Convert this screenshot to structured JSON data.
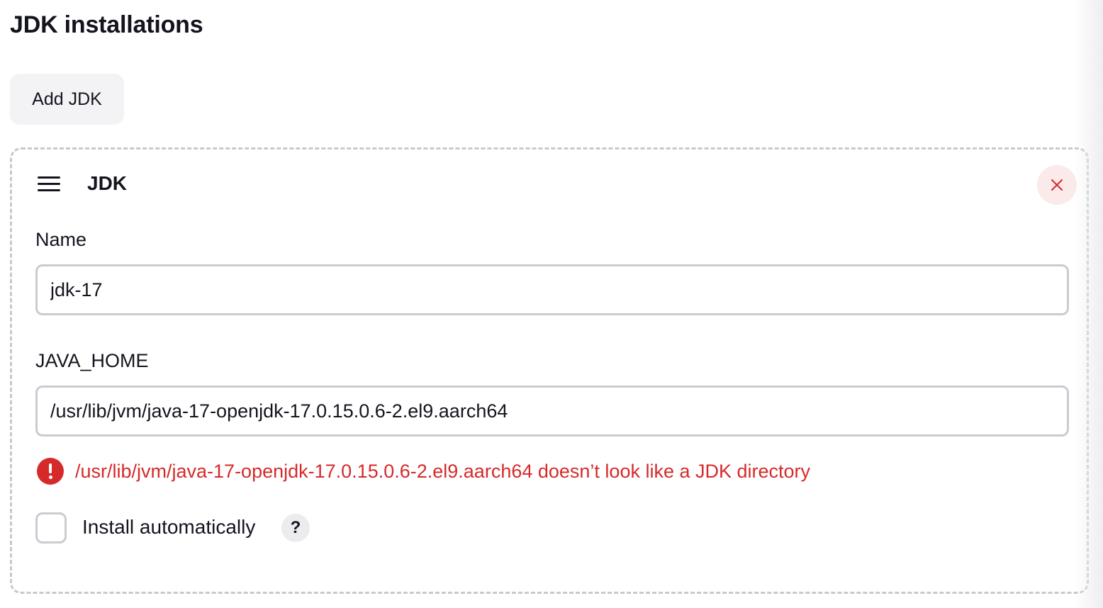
{
  "section": {
    "title": "JDK installations",
    "add_button_label": "Add JDK"
  },
  "jdk_block": {
    "title": "JDK",
    "name_field": {
      "label": "Name",
      "value": "jdk-17"
    },
    "java_home_field": {
      "label": "JAVA_HOME",
      "value": "/usr/lib/jvm/java-17-openjdk-17.0.15.0.6-2.el9.aarch64"
    },
    "error": {
      "icon": "exclamation-circle-icon",
      "message": "/usr/lib/jvm/java-17-openjdk-17.0.15.0.6-2.el9.aarch64 doesn’t look like a JDK directory"
    },
    "install_automatically": {
      "label": "Install automatically",
      "checked": false,
      "help_label": "?"
    },
    "delete_icon": "close-icon",
    "drag_icon": "drag-handle-icon"
  },
  "colors": {
    "error": "#d62a2a",
    "delete_background": "#fbeaea",
    "button_background": "#f3f3f5",
    "input_border": "#c9ccd1",
    "text": "#14141f"
  }
}
